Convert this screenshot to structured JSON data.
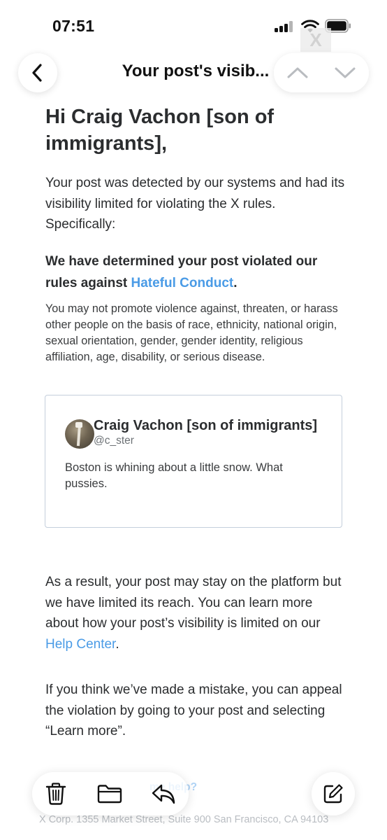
{
  "status_bar": {
    "time": "07:51",
    "icons": [
      "cellular-signal-icon",
      "wifi-icon",
      "battery-icon"
    ]
  },
  "nav": {
    "title": "Your post's visib...",
    "icons": [
      "chevron-left-icon",
      "chevron-up-icon",
      "chevron-down-icon"
    ]
  },
  "email": {
    "greeting": "Hi Craig Vachon [son of immigrants],",
    "intro": "Your post was detected by our systems and had its visibility limited for violating the X rules. Specifically:",
    "determination_prefix": "We have determined your post violated our rules against ",
    "determination_link": "Hateful Conduct",
    "determination_suffix": ".",
    "policy_text": "You may not promote violence against, threaten, or harass other people on the basis of race, ethnicity, national origin, sexual orientation, gender, gender identity, religious affiliation, age, disability, or serious disease.",
    "post": {
      "author_name": "Craig Vachon [son of immigrants]",
      "handle": "@c_ster",
      "text": "Boston is whining about a little snow. What pussies."
    },
    "result_prefix": "As a result, your post may stay on the platform but we have limited its reach. You can learn more about how your post’s visibility is limited on our ",
    "result_link": "Help Center",
    "result_suffix": ".",
    "appeal": "If you think we’ve made a mistake, you can appeal the violation by going to your post and selecting “Learn more”.",
    "help_fragment": "me help?",
    "footer_address": "X Corp. 1355 Market Street, Suite 900 San Francisco, CA 94103"
  },
  "toolbar": {
    "icons": [
      "trash-icon",
      "folder-icon",
      "reply-icon",
      "compose-icon"
    ]
  },
  "colors": {
    "link": "#4a9be6",
    "text": "#2b2d2f",
    "card_border": "#c4cfdc"
  }
}
